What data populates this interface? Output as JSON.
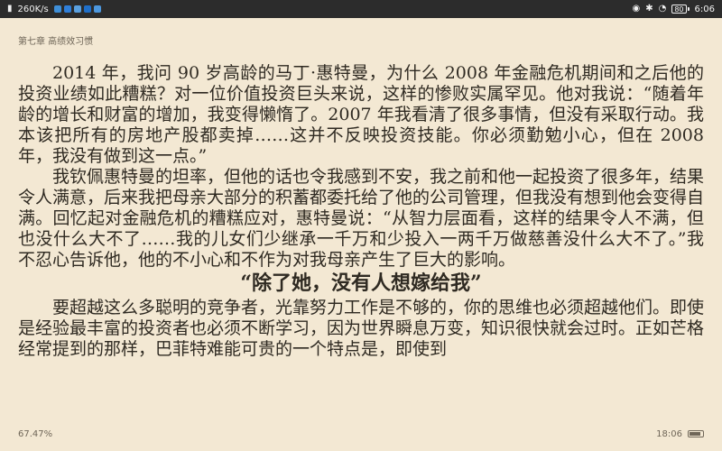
{
  "status_bar": {
    "network_speed": "260K/s",
    "wifi_icon": "wifi-icon",
    "bluetooth_icon": "bluetooth-icon",
    "battery_level": "80",
    "time": "6:06",
    "app_icons": [
      "app-icon-1",
      "app-icon-2",
      "app-icon-3",
      "app-icon-4",
      "app-icon-5"
    ]
  },
  "book": {
    "chapter_title": "第七章 高绩效习惯",
    "paragraphs": [
      "2014 年，我问 90 岁高龄的马丁·惠特曼，为什么 2008 年金融危机期间和之后他的投资业绩如此糟糕？对一位价值投资巨头来说，这样的惨败实属罕见。他对我说：“随着年龄的增长和财富的增加，我变得懒惰了。2007 年我看清了很多事情，但没有采取行动。我本该把所有的房地产股都卖掉……这并不反映投资技能。你必须勤勉小心，但在 2008 年，我没有做到这一点。”",
      "我钦佩惠特曼的坦率，但他的话也令我感到不安，我之前和他一起投资了很多年，结果令人满意，后来我把母亲大部分的积蓄都委托给了他的公司管理，但我没有想到他会变得自满。回忆起对金融危机的糟糕应对，惠特曼说：“从智力层面看，这样的结果令人不满，但也没什么大不了……我的儿女们少继承一千万和少投入一两千万做慈善没什么大不了。”我不忍心告诉他，他的不小心和不作为对我母亲产生了巨大的影响。"
    ],
    "section_heading": "“除了她，没有人想嫁给我”",
    "paragraph_after": "要超越这么多聪明的竞争者，光靠努力工作是不够的，你的思维也必须超越他们。即使是经验最丰富的投资者也必须不断学习，因为世界瞬息万变，知识很快就会过时。正如芒格经常提到的那样，巴菲特难能可贵的一个特点是，即使到"
  },
  "footer": {
    "progress": "67.47%",
    "clock": "18:06"
  }
}
